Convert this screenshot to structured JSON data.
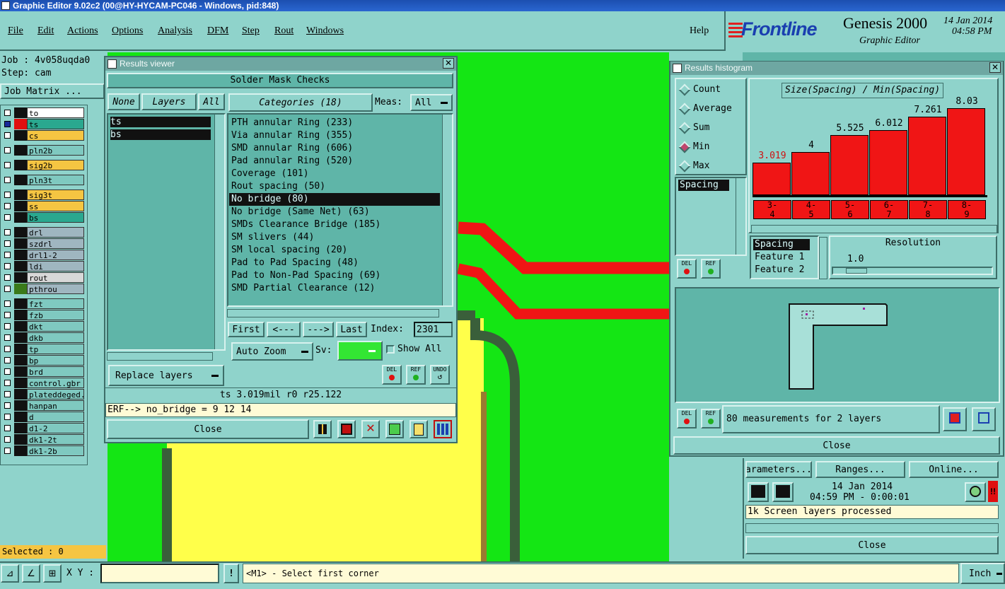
{
  "window": {
    "title": "Graphic Editor 9.02c2 (00@HY-HYCAM-PC046 - Windows, pid:848)"
  },
  "menu": {
    "items": [
      "File",
      "Edit",
      "Actions",
      "Options",
      "Analysis",
      "DFM",
      "Step",
      "Rout",
      "Windows"
    ],
    "help": "Help"
  },
  "brand": {
    "logo": "Frontline",
    "product": "Genesis 2000",
    "subtitle": "Graphic Editor",
    "date": "14 Jan 2014",
    "time": "04:58 PM"
  },
  "job": {
    "job_label": "Job : 4v058uqda0",
    "step_label": "Step: cam",
    "matrix_button": "Job Matrix ..."
  },
  "layers": [
    {
      "name": "to",
      "color": "#ffffff",
      "mark": "#111111"
    },
    {
      "name": "ts",
      "color": "#2aa88f",
      "mark": "#e01010",
      "selected": true
    },
    {
      "name": "cs",
      "color": "#f5c542",
      "mark": "#111111"
    },
    {
      "name": "pln2b",
      "color": "#7fc9c0",
      "mark": "#111111"
    },
    {
      "name": "sig2b",
      "color": "#f5c542",
      "mark": "#111111"
    },
    {
      "name": "pln3t",
      "color": "#7fc9c0",
      "mark": "#111111"
    },
    {
      "name": "sig3t",
      "color": "#f5c542",
      "mark": "#111111"
    },
    {
      "name": "ss",
      "color": "#f5c542",
      "mark": "#111111"
    },
    {
      "name": "bs",
      "color": "#2aa88f",
      "mark": "#111111"
    },
    {
      "name": "drl",
      "color": "#9fb6c0",
      "mark": "#111111"
    },
    {
      "name": "szdrl",
      "color": "#9fb6c0",
      "mark": "#111111"
    },
    {
      "name": "drl1-2",
      "color": "#9fb6c0",
      "mark": "#111111"
    },
    {
      "name": "ldi",
      "color": "#9fb6c0",
      "mark": "#111111"
    },
    {
      "name": "rout",
      "color": "#d8d8d8",
      "mark": "#111111"
    },
    {
      "name": "pthrou",
      "color": "#9fb6c0",
      "mark": "#3a7a1a"
    },
    {
      "name": "fzt",
      "color": "#7fc9c0",
      "mark": "#111111"
    },
    {
      "name": "fzb",
      "color": "#7fc9c0",
      "mark": "#111111"
    },
    {
      "name": "dkt",
      "color": "#7fc9c0",
      "mark": "#111111"
    },
    {
      "name": "dkb",
      "color": "#7fc9c0",
      "mark": "#111111"
    },
    {
      "name": "tp",
      "color": "#7fc9c0",
      "mark": "#111111"
    },
    {
      "name": "bp",
      "color": "#7fc9c0",
      "mark": "#111111"
    },
    {
      "name": "brd",
      "color": "#7fc9c0",
      "mark": "#111111"
    },
    {
      "name": "control.gbr",
      "color": "#7fc9c0",
      "mark": "#111111"
    },
    {
      "name": "plateddeged.g",
      "color": "#7fc9c0",
      "mark": "#111111"
    },
    {
      "name": "hanpan",
      "color": "#7fc9c0",
      "mark": "#111111"
    },
    {
      "name": "d",
      "color": "#7fc9c0",
      "mark": "#111111"
    },
    {
      "name": "d1-2",
      "color": "#7fc9c0",
      "mark": "#111111"
    },
    {
      "name": "dk1-2t",
      "color": "#7fc9c0",
      "mark": "#111111"
    },
    {
      "name": "dk1-2b",
      "color": "#7fc9c0",
      "mark": "#111111"
    }
  ],
  "selected_label": "Selected : 0",
  "results_viewer": {
    "title": "Results viewer",
    "header": "Solder Mask Checks",
    "none_btn": "None",
    "layers_btn": "Layers",
    "all_btn": "All",
    "categories_btn": "Categories (18)",
    "meas_label": "Meas:",
    "meas_value": "All",
    "layer_list": [
      "ts",
      "bs"
    ],
    "categories": [
      "PTH annular Ring (233)",
      "Via annular Ring (355)",
      "SMD annular Ring (606)",
      "Pad annular Ring (520)",
      "Coverage (101)",
      "Rout spacing (50)",
      "No bridge (80)",
      "No bridge (Same Net) (63)",
      "SMDs Clearance Bridge (185)",
      "SM slivers (44)",
      "SM local spacing (20)",
      "Pad to Pad Spacing (48)",
      "Pad to Non-Pad Spacing (69)",
      "SMD Partial Clearance (12)"
    ],
    "selected_category": 6,
    "first": "First",
    "prev": "<---",
    "next": "--->",
    "last": "Last",
    "index_label": "Index:",
    "index_value": "2301",
    "zoom": "Auto Zoom",
    "sv_label": "Sv:",
    "show_all": "Show All",
    "replace_layers": "Replace layers",
    "status": "ts 3.019mil   r0   r25.122",
    "erf": "ERF--> no_bridge = 9 12 14",
    "close": "Close",
    "del": "DEL",
    "ref": "REF",
    "undo": "UNDO"
  },
  "histogram": {
    "title": "Results histogram",
    "options": [
      "Count",
      "Average",
      "Sum",
      "Min",
      "Max"
    ],
    "selected_option": "Min",
    "measure_list": [
      "Spacing"
    ],
    "chart_title": "Size(Spacing) / Min(Spacing)",
    "resolution_label": "Resolution",
    "resolution_value": "1.0",
    "features": [
      "Spacing",
      "Feature 1",
      "Feature 2"
    ],
    "info": "80 measurements for 2 layers",
    "close": "Close",
    "del": "DEL",
    "ref": "REF"
  },
  "chart_data": {
    "type": "bar",
    "title": "Size(Spacing) / Min(Spacing)",
    "categories": [
      "3-4",
      "4-5",
      "5-6",
      "6-7",
      "7-8",
      "8-9"
    ],
    "values": [
      3.019,
      4,
      5.525,
      6.012,
      7.261,
      8.03
    ],
    "labels": [
      "3.019",
      "4",
      "5.525",
      "6.012",
      "7.261",
      "8.03"
    ],
    "ylim": [
      0,
      8.5
    ],
    "bar_color": "#f01515",
    "first_label_color": "#d01010"
  },
  "bottom_right_panel": {
    "parameters": "arameters...",
    "ranges": "Ranges...",
    "online": "Online...",
    "date": "14 Jan 2014",
    "time": "04:59 PM - 0:00:01",
    "status": "1k Screen layers processed",
    "close": "Close"
  },
  "statusbar": {
    "xy_label": "X Y :",
    "xy_value": "",
    "exclaim": "!",
    "prompt": "<M1> - Select first corner",
    "unit": "Inch"
  }
}
